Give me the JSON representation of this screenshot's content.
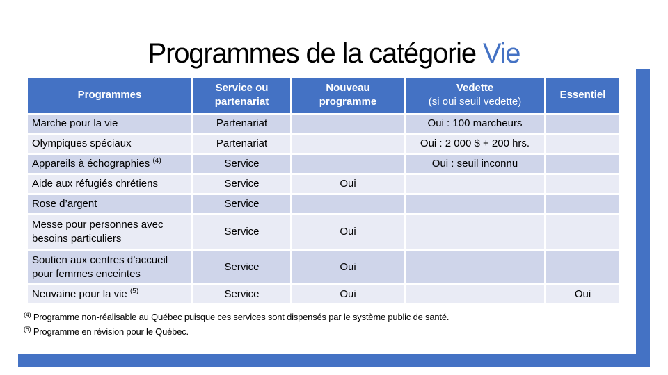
{
  "title": {
    "main": "Programmes de la catégorie ",
    "accent": "Vie",
    "accent_color": "#4472C4"
  },
  "colors": {
    "header_bg": "#4472C4",
    "row_odd_bg": "#CFD5EA",
    "row_even_bg": "#E9EBF5",
    "frame": "#4472C4"
  },
  "table": {
    "headers": [
      {
        "line1": "Programmes",
        "line2": ""
      },
      {
        "line1": "Service ou",
        "line2": "partenariat"
      },
      {
        "line1": "Nouveau",
        "line2": "programme"
      },
      {
        "line1": "Vedette",
        "line2": "(si oui seuil vedette)"
      },
      {
        "line1": "Essentiel",
        "line2": ""
      }
    ],
    "rows": [
      {
        "program": "Marche pour la vie",
        "note": "",
        "type": "Partenariat",
        "new": "",
        "featured": "Oui : 100 marcheurs",
        "essential": ""
      },
      {
        "program": "Olympiques spéciaux",
        "note": "",
        "type": "Partenariat",
        "new": "",
        "featured": "Oui : 2 000 $ + 200 hrs.",
        "essential": ""
      },
      {
        "program": "Appareils à échographies",
        "note": "(4)",
        "type": "Service",
        "new": "",
        "featured": "Oui : seuil inconnu",
        "essential": ""
      },
      {
        "program": "Aide aux réfugiés chrétiens",
        "note": "",
        "type": "Service",
        "new": "Oui",
        "featured": "",
        "essential": ""
      },
      {
        "program": "Rose d’argent",
        "note": "",
        "type": "Service",
        "new": "",
        "featured": "",
        "essential": ""
      },
      {
        "program": "Messe pour personnes avec besoins particuliers",
        "note": "",
        "type": "Service",
        "new": "Oui",
        "featured": "",
        "essential": ""
      },
      {
        "program": "Soutien aux centres d’accueil pour femmes enceintes",
        "note": "",
        "type": "Service",
        "new": "Oui",
        "featured": "",
        "essential": ""
      },
      {
        "program": "Neuvaine pour la vie",
        "note": "(5)",
        "type": "Service",
        "new": "Oui",
        "featured": "",
        "essential": "Oui"
      }
    ]
  },
  "footnotes": [
    {
      "mark": "(4)",
      "text": "Programme non-réalisable au Québec puisque ces services sont dispensés par le système public de santé."
    },
    {
      "mark": "(5)",
      "text": "Programme en révision pour le Québec."
    }
  ]
}
